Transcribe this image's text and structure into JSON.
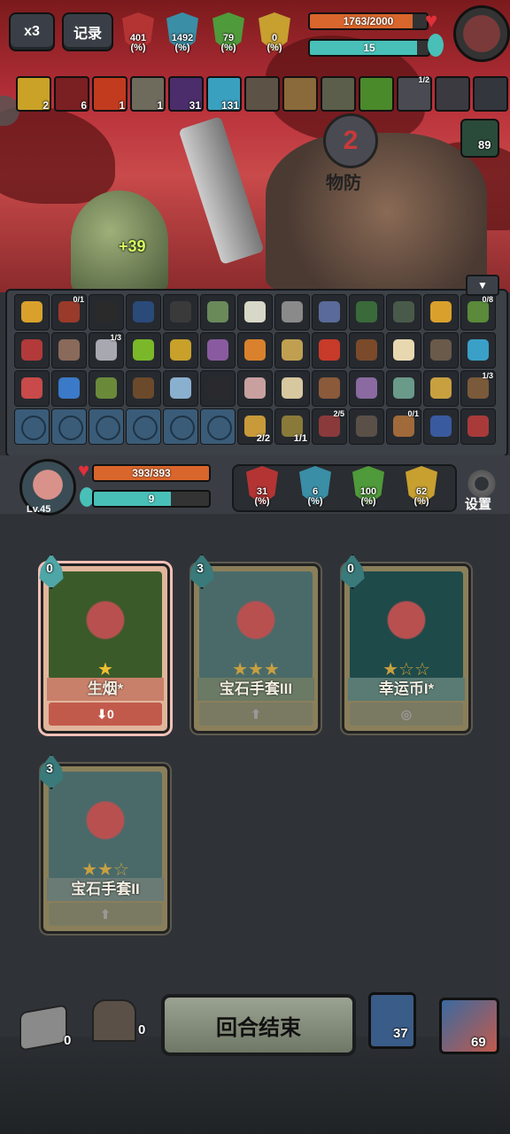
{
  "top": {
    "speed_label": "x3",
    "record_label": "记录",
    "stats": [
      {
        "value": "401",
        "unit": "(%)",
        "color": "#b43434"
      },
      {
        "value": "1492",
        "unit": "(%)",
        "color": "#3a8ea6"
      },
      {
        "value": "79",
        "unit": "(%)",
        "color": "#4f9a3a"
      },
      {
        "value": "0",
        "unit": "(%)",
        "color": "#c7a030"
      }
    ],
    "enemy_hp": "1763/2000",
    "enemy_hp_fraction": 0.88,
    "enemy_mana": "15",
    "enemy_mana_fraction": 0.9
  },
  "buffs": [
    {
      "icon": "lightning-icon",
      "count": "2",
      "color": "#c9a227"
    },
    {
      "icon": "claw-icon",
      "count": "6",
      "color": "#7a1f22"
    },
    {
      "icon": "demon-icon",
      "count": "1",
      "color": "#c23b1e"
    },
    {
      "icon": "armor-icon",
      "count": "1",
      "color": "#6e6a5c"
    },
    {
      "icon": "hood-icon",
      "count": "31",
      "color": "#4a2d6a"
    },
    {
      "icon": "ghost-icon",
      "count": "131",
      "color": "#3aa0c0"
    },
    {
      "icon": "book-icon",
      "count": "",
      "color": "#5c5246"
    },
    {
      "icon": "horn-icon",
      "count": "",
      "color": "#8a6a3a"
    },
    {
      "icon": "warrior-icon",
      "count": "",
      "color": "#5a5e4a"
    },
    {
      "icon": "green-gem-icon",
      "count": "",
      "color": "#4a8a2a"
    },
    {
      "icon": "trap-icon",
      "count": "",
      "top": "1/2",
      "color": "#4a4a52"
    },
    {
      "icon": "beast-icon",
      "count": "",
      "color": "#3a3a40"
    },
    {
      "icon": "shadow-icon",
      "count": "",
      "color": "#33363d"
    }
  ],
  "enemy": {
    "intent_label": "物防",
    "skull_count": "89",
    "level_number": "2"
  },
  "heal_popup": "+39",
  "relics": [
    {
      "color": "#d9a12c"
    },
    {
      "color": "#9a3a2a",
      "c": "0/1"
    },
    {
      "color": "#2a2a2a"
    },
    {
      "color": "#2a4a7a"
    },
    {
      "color": "#3a3a3a"
    },
    {
      "color": "#6a8a5a"
    },
    {
      "color": "#d8d8c8"
    },
    {
      "color": "#8a8a8a"
    },
    {
      "color": "#5a6a9a"
    },
    {
      "color": "#3a6a3a"
    },
    {
      "color": "#4a5a4a"
    },
    {
      "color": "#d9a12c"
    },
    {
      "color": "#5a8a3a",
      "c": "0/8"
    },
    {
      "color": "#b23a3a"
    },
    {
      "color": "#8a6a5a"
    },
    {
      "color": "#a8a8b0",
      "c": "1/3"
    },
    {
      "color": "#7ab82a"
    },
    {
      "color": "#c8a02a"
    },
    {
      "color": "#8a5aa0"
    },
    {
      "color": "#d9812c"
    },
    {
      "color": "#c0a050"
    },
    {
      "color": "#c83a2a"
    },
    {
      "color": "#7a4a2a"
    },
    {
      "color": "#e8d8b0"
    },
    {
      "color": "#6a5a4a"
    },
    {
      "color": "#3aa0c8"
    },
    {
      "color": "#c84a4a"
    },
    {
      "color": "#3a7ac8"
    },
    {
      "color": "#6a8a3a"
    },
    {
      "color": "#6a4a2a"
    },
    {
      "color": "#8ab0d0"
    },
    {
      "color": "#2a2a2e"
    },
    {
      "color": "#c8a0a0"
    },
    {
      "color": "#d8c8a0"
    },
    {
      "color": "#8a5a3a"
    },
    {
      "color": "#8a6aa0"
    },
    {
      "color": "#6a9a8a"
    },
    {
      "color": "#c8a040"
    },
    {
      "color": "#7a5a3a",
      "c": "1/3"
    },
    {
      "color": "#3a5c78",
      "locked": true
    },
    {
      "color": "#3a5c78",
      "locked": true
    },
    {
      "color": "#3a5c78",
      "locked": true
    },
    {
      "color": "#3a5c78",
      "locked": true
    },
    {
      "color": "#3a5c78",
      "locked": true
    },
    {
      "color": "#3a5c78",
      "locked": true
    },
    {
      "color": "#c89a3a",
      "cb": "2/2"
    },
    {
      "color": "#8a7a3a",
      "cb": "1/1"
    },
    {
      "color": "#8a3a3a",
      "c": "2/5"
    },
    {
      "color": "#5a5048"
    },
    {
      "color": "#a06a3a",
      "c": "0/1"
    },
    {
      "color": "#3a5aa0"
    },
    {
      "color": "#a83a3a"
    }
  ],
  "hero": {
    "hp": "393/393",
    "hp_fraction": 1,
    "mana": "9",
    "mana_fraction": 0.67,
    "level": "Lv.45",
    "stats": [
      {
        "value": "31",
        "unit": "(%)",
        "color": "#b43434"
      },
      {
        "value": "6",
        "unit": "(%)",
        "color": "#3a8ea6"
      },
      {
        "value": "100",
        "unit": "(%)",
        "color": "#4f9a3a"
      },
      {
        "value": "62",
        "unit": "(%)",
        "color": "#c7a030"
      }
    ],
    "settings_label": "设置"
  },
  "cards": [
    {
      "name": "生烟*",
      "cost": "0",
      "stars": "★",
      "foot": "0",
      "art": "#3a5a2a",
      "active": true
    },
    {
      "name": "宝石手套III",
      "cost": "3",
      "stars": "★★★",
      "foot": "",
      "art": "#4a6a6a",
      "active": false
    },
    {
      "name": "幸运币I*",
      "cost": "0",
      "stars": "★☆☆",
      "foot": "",
      "art": "#1e4a4a",
      "active": false
    },
    {
      "name": "宝石手套II",
      "cost": "3",
      "stars": "★★☆",
      "foot": "",
      "art": "#4a6a6a",
      "active": false
    }
  ],
  "bottom": {
    "end_turn_label": "回合结束",
    "draw_pile": "0",
    "grave_pile": "0",
    "potion_count": "37",
    "deck_count": "69"
  }
}
